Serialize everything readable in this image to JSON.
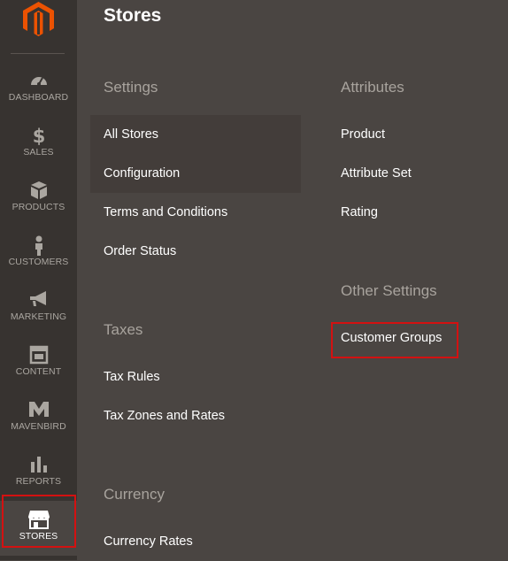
{
  "sidebar": {
    "items": [
      {
        "label": "DASHBOARD",
        "icon": "dashboard-icon"
      },
      {
        "label": "SALES",
        "icon": "dollar-icon"
      },
      {
        "label": "PRODUCTS",
        "icon": "box-icon"
      },
      {
        "label": "CUSTOMERS",
        "icon": "person-icon"
      },
      {
        "label": "MARKETING",
        "icon": "megaphone-icon"
      },
      {
        "label": "CONTENT",
        "icon": "layout-icon"
      },
      {
        "label": "MAVENBIRD",
        "icon": "mavenbird-icon"
      },
      {
        "label": "REPORTS",
        "icon": "bar-chart-icon"
      },
      {
        "label": "STORES",
        "icon": "store-icon",
        "active": true
      }
    ]
  },
  "panel": {
    "title": "Stores",
    "settings": {
      "title": "Settings",
      "links": [
        "All Stores",
        "Configuration",
        "Terms and Conditions",
        "Order Status"
      ]
    },
    "taxes": {
      "title": "Taxes",
      "links": [
        "Tax Rules",
        "Tax Zones and Rates"
      ]
    },
    "currency": {
      "title": "Currency",
      "links": [
        "Currency Rates"
      ]
    },
    "attributes": {
      "title": "Attributes",
      "links": [
        "Product",
        "Attribute Set",
        "Rating"
      ]
    },
    "other_settings": {
      "title": "Other Settings",
      "links": [
        "Customer Groups"
      ]
    }
  },
  "colors": {
    "sidebar_bg": "#373330",
    "panel_bg": "#4a4542",
    "highlight_border": "#d31111",
    "logo_orange": "#eb5202"
  }
}
